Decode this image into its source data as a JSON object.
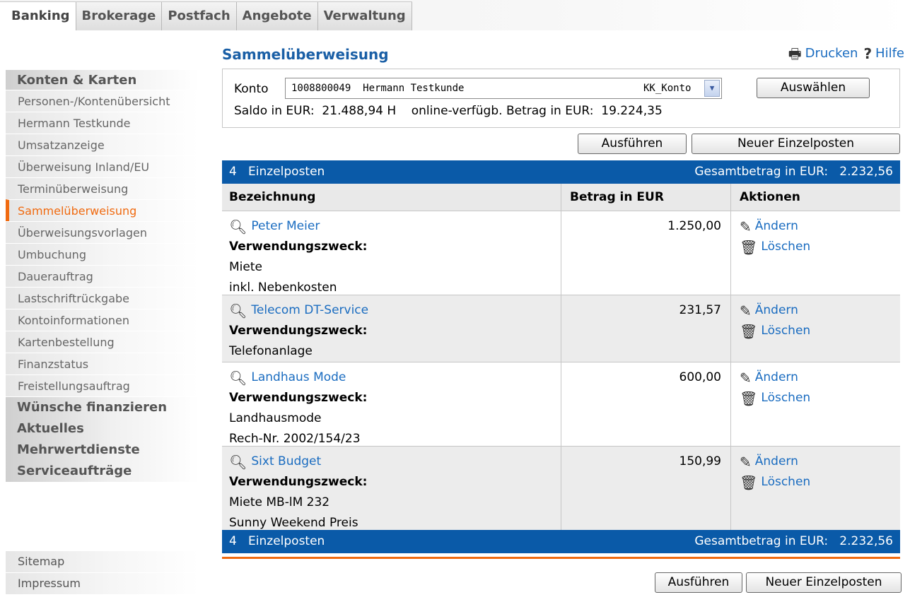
{
  "topnav": {
    "tabs": [
      "Banking",
      "Brokerage",
      "Postfach",
      "Angebote",
      "Verwaltung"
    ]
  },
  "sidebar": {
    "section_konten": "Konten & Karten",
    "items": [
      "Personen-/Kontenübersicht",
      "Hermann Testkunde",
      "Umsatzanzeige",
      "Überweisung Inland/EU",
      "Terminüberweisung",
      "Sammelüberweisung",
      "Überweisungsvorlagen",
      "Umbuchung",
      "Dauerauftrag",
      "Lastschriftrückgabe",
      "Kontoinformationen",
      "Kartenbestellung",
      "Finanzstatus",
      "Freistellungsauftrag"
    ],
    "active_item": "Sammelüberweisung",
    "sections": [
      "Wünsche finanzieren",
      "Aktuelles",
      "Mehrwertdienste",
      "Serviceaufträge"
    ],
    "footer": [
      "Sitemap",
      "Impressum"
    ]
  },
  "main": {
    "title": "Sammelüberweisung",
    "print_label": "Drucken",
    "help_label": "Hilfe",
    "konto_label": "Konto",
    "konto_value": "1008800049  Hermann Testkunde",
    "konto_type": "KK_Konto",
    "select_button": "Auswählen",
    "saldo": "Saldo in EUR:  21.488,94 H    online-verfügb. Betrag in EUR:  19.224,35",
    "execute_button": "Ausführen",
    "new_item_button": "Neuer Einzelposten"
  },
  "table": {
    "count_label": "4   Einzelposten",
    "total_label": "Gesamtbetrag in EUR:   2.232,56",
    "headers": [
      "Bezeichnung",
      "Betrag in EUR",
      "Aktionen"
    ],
    "purpose_label": "Verwendungszweck:",
    "edit_label": "Ändern",
    "delete_label": "Löschen",
    "rows": [
      {
        "name": "Peter Meier",
        "amount": "1.250,00",
        "purpose1": "Miete",
        "purpose2": "inkl. Nebenkosten"
      },
      {
        "name": "Telecom DT-Service",
        "amount": "231,57",
        "purpose1": "Telefonanlage",
        "purpose2": ""
      },
      {
        "name": "Landhaus Mode",
        "amount": "600,00",
        "purpose1": "Landhausmode",
        "purpose2": "Rech-Nr. 2002/154/23"
      },
      {
        "name": "Sixt Budget",
        "amount": "150,99",
        "purpose1": "Miete MB-lM 232",
        "purpose2": "Sunny Weekend Preis"
      }
    ]
  },
  "icons": {
    "print": "printer-icon",
    "help": "help-icon",
    "view": "magnifier-icon",
    "edit": "pencil-icon",
    "delete": "trash-icon"
  },
  "colors": {
    "brand_blue": "#0a5aa8",
    "link_blue": "#1a6cc0",
    "active_orange": "#f06a10"
  }
}
